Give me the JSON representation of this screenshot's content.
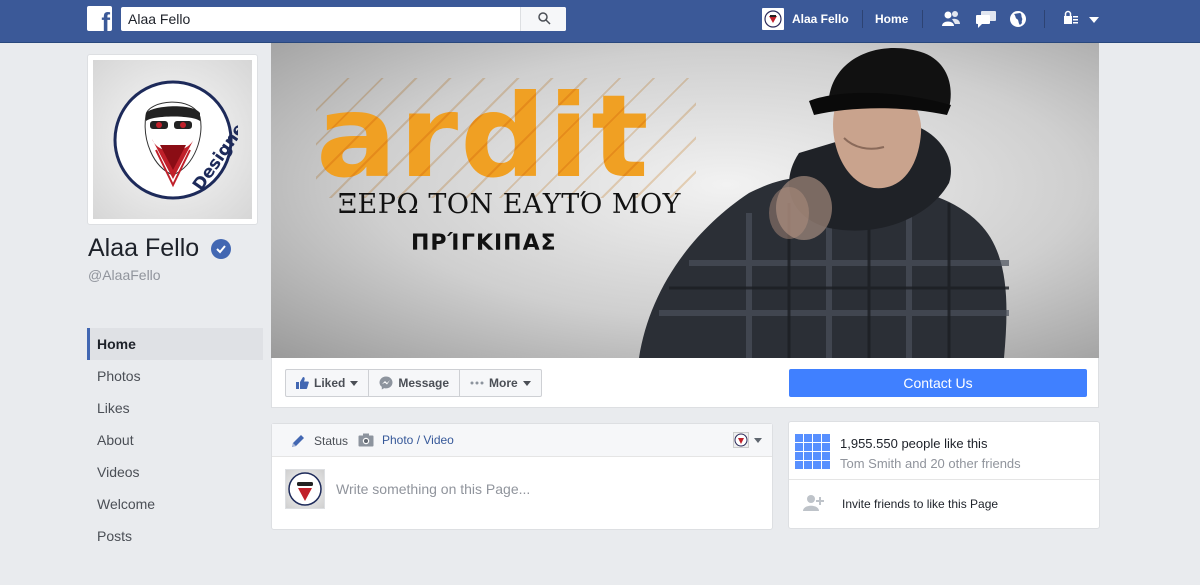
{
  "topbar": {
    "logo": "f",
    "search_value": "Alaa Fello",
    "profile_name": "Alaa Fello",
    "home_label": "Home",
    "icons": [
      "friends-icon",
      "messages-icon",
      "notifications-globe-icon",
      "privacy-lock-icon",
      "account-caret-icon"
    ]
  },
  "profile": {
    "name": "Alaa Fello",
    "handle": "@AlaaFello",
    "verified": true
  },
  "side_nav": [
    {
      "label": "Home",
      "active": true
    },
    {
      "label": "Photos"
    },
    {
      "label": "Likes"
    },
    {
      "label": "About"
    },
    {
      "label": "Videos"
    },
    {
      "label": "Welcome"
    },
    {
      "label": "Posts"
    }
  ],
  "cover": {
    "word": "ardit",
    "line1": "ΞΕΡΩ ΤΟΝ ΕΑΥΤΌ ΜΟΥ",
    "line2": "ΠΡΊΓΚΙΠΑΣ"
  },
  "actions": {
    "liked": "Liked",
    "message": "Message",
    "more": "More",
    "contact": "Contact Us"
  },
  "composer": {
    "status_tab": "Status",
    "photo_tab": "Photo / Video",
    "placeholder": "Write something on this Page..."
  },
  "likes": {
    "count_text": "1,955.550 people like this",
    "friends_text": "Tom Smith and 20 other friends",
    "invite_text": "Invite friends to like this Page"
  },
  "colors": {
    "topbar": "#3b5998",
    "accent": "#4080ff",
    "cover_orange": "#f0a023"
  }
}
